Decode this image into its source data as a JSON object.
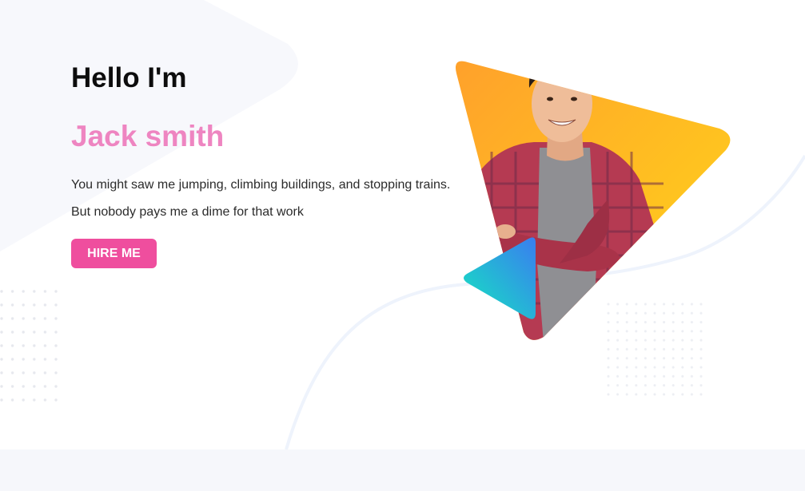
{
  "hero": {
    "greeting": "Hello I'm",
    "name": "Jack smith",
    "bio_line1": "You might saw me jumping, climbing buildings, and stopping trains.",
    "bio_line2": "But nobody pays me a dime for that work",
    "cta_label": "HIRE ME"
  },
  "colors": {
    "name_pink": "#ee85c1",
    "button_pink": "#ef4e9e",
    "triangle_orange": "#ffa12b",
    "triangle_yellow": "#ffd619",
    "play_teal": "#14e6c0",
    "play_blue": "#3a7df0",
    "band_gray": "#f6f7fb"
  },
  "icons": {
    "hero_shape": "orange-yellow-triangle",
    "play_shape": "teal-blue-play-triangle",
    "portrait": "smiling-man-plaid-shirt"
  }
}
